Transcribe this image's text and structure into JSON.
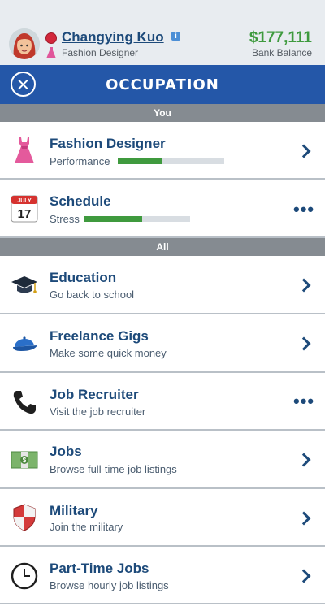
{
  "header": {
    "player_name": "Changying Kuo",
    "player_job": "Fashion Designer",
    "bank_amount": "$177,111",
    "bank_label": "Bank Balance",
    "info_icon": "info-icon",
    "status_color": "#d2273b"
  },
  "title_bar": {
    "title": "OCCUPATION",
    "close_icon": "close-icon",
    "color": "#2457a8"
  },
  "sections": {
    "you": "You",
    "all": "All"
  },
  "you_items": [
    {
      "title": "Fashion Designer",
      "subtitle": "Performance",
      "bar_fraction": 0.42,
      "icon": "dress-icon",
      "action": "chevron-right"
    },
    {
      "title": "Schedule",
      "subtitle": "Stress",
      "bar_fraction": 0.55,
      "icon": "calendar-icon",
      "calendar_month": "JULY",
      "calendar_day": "17",
      "action": "more"
    }
  ],
  "all_items": [
    {
      "title": "Education",
      "subtitle": "Go back to school",
      "icon": "graduation-cap-icon",
      "action": "chevron-right"
    },
    {
      "title": "Freelance Gigs",
      "subtitle": "Make some quick money",
      "icon": "baseball-cap-icon",
      "action": "chevron-right"
    },
    {
      "title": "Job Recruiter",
      "subtitle": "Visit the job recruiter",
      "icon": "phone-icon",
      "action": "more"
    },
    {
      "title": "Jobs",
      "subtitle": "Browse full-time job listings",
      "icon": "money-icon",
      "action": "chevron-right"
    },
    {
      "title": "Military",
      "subtitle": "Join the military",
      "icon": "shield-icon",
      "action": "chevron-right"
    },
    {
      "title": "Part-Time Jobs",
      "subtitle": "Browse hourly job listings",
      "icon": "clock-icon",
      "action": "chevron-right"
    }
  ],
  "more_glyph": "•••",
  "colors": {
    "bar_fill": "#3f9a3e",
    "bank": "#3e9a3e",
    "accent_text": "#1d4a7a"
  }
}
